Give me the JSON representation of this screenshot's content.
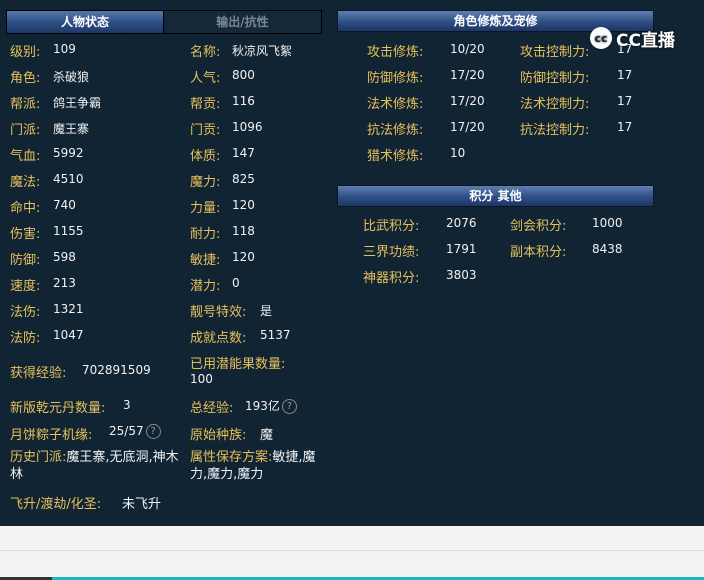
{
  "tabs": {
    "active": "人物状态",
    "inactive": "输出/抗性"
  },
  "left": {
    "rows": [
      {
        "l1": "级别:",
        "v1": "109",
        "l2": "名称:",
        "v2": "秋凉风飞絮"
      },
      {
        "l1": "角色:",
        "v1": "杀破狼",
        "l2": "人气:",
        "v2": "800"
      },
      {
        "l1": "帮派:",
        "v1": "鸽王争霸",
        "l2": "帮贡:",
        "v2": "116"
      },
      {
        "l1": "门派:",
        "v1": "魔王寨",
        "l2": "门贡:",
        "v2": "1096"
      },
      {
        "l1": "气血:",
        "v1": "5992",
        "l2": "体质:",
        "v2": "147"
      },
      {
        "l1": "魔法:",
        "v1": "4510",
        "l2": "魔力:",
        "v2": "825"
      },
      {
        "l1": "命中:",
        "v1": "740",
        "l2": "力量:",
        "v2": "120"
      },
      {
        "l1": "伤害:",
        "v1": "1155",
        "l2": "耐力:",
        "v2": "118"
      },
      {
        "l1": "防御:",
        "v1": "598",
        "l2": "敏捷:",
        "v2": "120"
      },
      {
        "l1": "速度:",
        "v1": "213",
        "l2": "潜力:",
        "v2": "0"
      },
      {
        "l1": "法伤:",
        "v1": "1321",
        "l2": "靓号特效:",
        "v2": "是"
      },
      {
        "l1": "法防:",
        "v1": "1047",
        "l2": "成就点数:",
        "v2": "5137"
      }
    ],
    "exp_label": "获得经验:",
    "exp_value": "702891509",
    "potential_label": "已用潜能果数量:",
    "potential_value": "100",
    "qiankun_label": "新版乾元丹数量:",
    "qiankun_value": "3",
    "total_exp_label": "总经验:",
    "total_exp_value": "193亿",
    "mooncake_label": "月饼粽子机缘:",
    "mooncake_value": "25/57",
    "race_label": "原始种族:",
    "race_value": "魔",
    "history_label": "历史门派:",
    "history_value": "魔王寨,无底洞,神木林",
    "attr_label": "属性保存方案:",
    "attr_value": "敏捷,魔力,魔力,魔力",
    "ascend_label": "飞升/渡劫/化圣:",
    "ascend_value": "未飞升"
  },
  "cultivation": {
    "title": "角色修炼及宠修",
    "rows": [
      {
        "l1": "攻击修炼:",
        "v1": "10/20",
        "l2": "攻击控制力:",
        "v2": "17"
      },
      {
        "l1": "防御修炼:",
        "v1": "17/20",
        "l2": "防御控制力:",
        "v2": "17"
      },
      {
        "l1": "法术修炼:",
        "v1": "17/20",
        "l2": "法术控制力:",
        "v2": "17"
      },
      {
        "l1": "抗法修炼:",
        "v1": "17/20",
        "l2": "抗法控制力:",
        "v2": "17"
      }
    ],
    "hunt_label": "猎术修炼:",
    "hunt_value": "10"
  },
  "points": {
    "title": "积分 其他",
    "rows": [
      {
        "l1": "比武积分:",
        "v1": "2076",
        "l2": "剑会积分:",
        "v2": "1000"
      },
      {
        "l1": "三界功绩:",
        "v1": "1791",
        "l2": "副本积分:",
        "v2": "8438"
      }
    ],
    "artifact_label": "神器积分:",
    "artifact_value": "3803"
  },
  "watermark": {
    "text": "CC直播",
    "mark": "cc"
  },
  "help_icon_glyph": "?",
  "colors": {
    "label": "#e8c05a",
    "value": "#f2f2f2",
    "background": "#102434",
    "header": "#2e4f85"
  }
}
